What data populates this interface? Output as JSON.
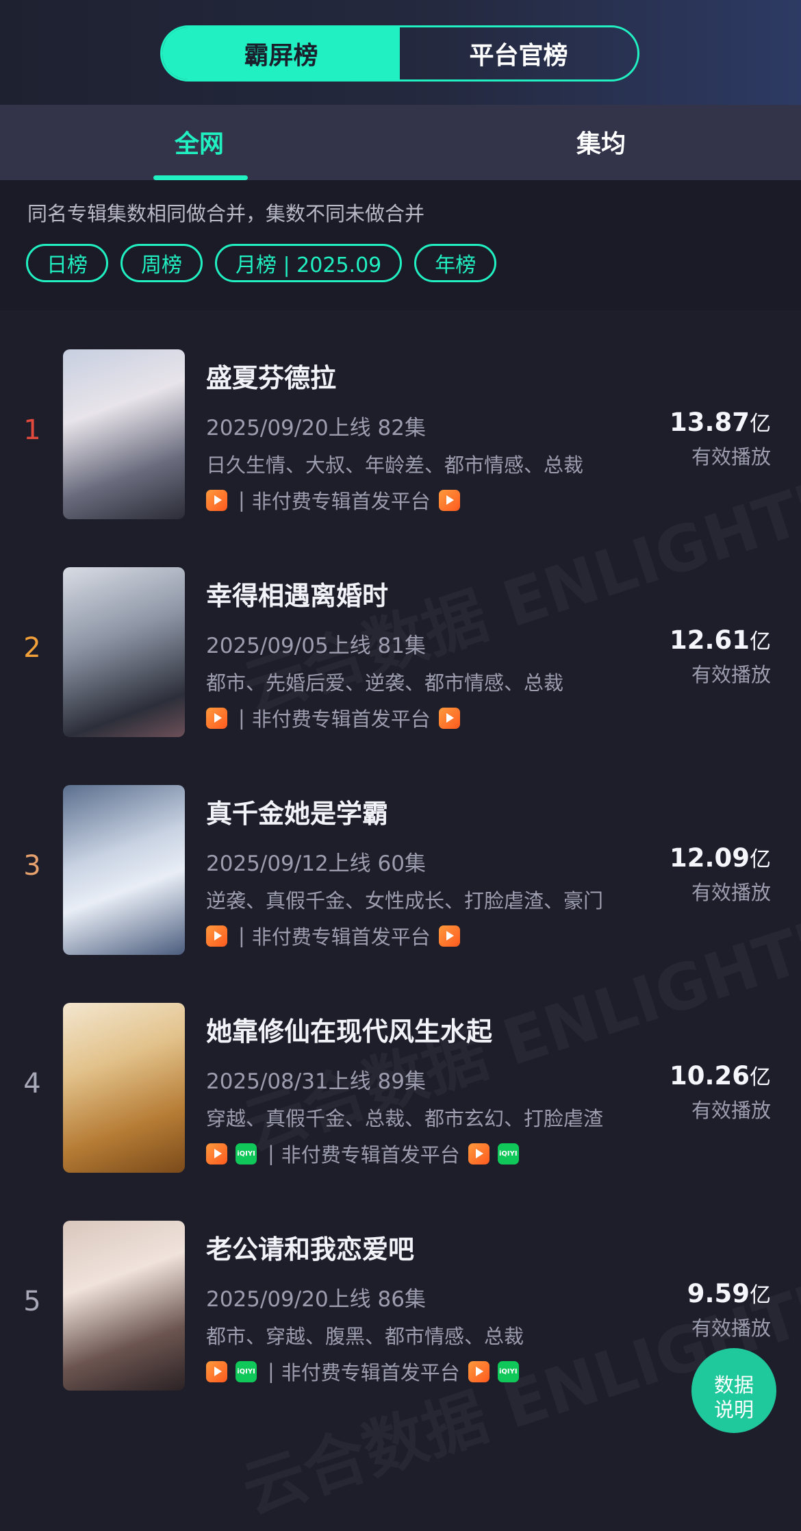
{
  "segments": [
    "霸屏榜",
    "平台官榜"
  ],
  "tabs": [
    "全网",
    "集均"
  ],
  "note": "同名专辑集数相同做合并，集数不同未做合并",
  "pills": [
    "日榜",
    "周榜",
    "月榜 | 2025.09",
    "年榜"
  ],
  "watermark_text": "云合数据 ENLIGHTENT",
  "play_label": "有效播放",
  "platform_text": "非付费专辑首发平台",
  "iqiyi_text": "iQIYI",
  "unit": "亿",
  "colors": {
    "accent": "#21f0c2",
    "rank1": "#e0493b",
    "rank2": "#f5a13a",
    "rank3": "#e7a26d",
    "rank_other": "#a8a9b8"
  },
  "items": [
    {
      "rank": "1",
      "title": "盛夏芬德拉",
      "meta": "2025/09/20上线 82集",
      "tags": "日久生情、大叔、年龄差、都市情感、总裁",
      "value": "13.87",
      "platforms": [
        "orange-play-icon"
      ]
    },
    {
      "rank": "2",
      "title": "幸得相遇离婚时",
      "meta": "2025/09/05上线 81集",
      "tags": "都市、先婚后爱、逆袭、都市情感、总裁",
      "value": "12.61",
      "platforms": [
        "orange-play-icon"
      ]
    },
    {
      "rank": "3",
      "title": "真千金她是学霸",
      "meta": "2025/09/12上线 60集",
      "tags": "逆袭、真假千金、女性成长、打脸虐渣、豪门",
      "value": "12.09",
      "platforms": [
        "orange-play-icon"
      ]
    },
    {
      "rank": "4",
      "title": "她靠修仙在现代风生水起",
      "meta": "2025/08/31上线 89集",
      "tags": "穿越、真假千金、总裁、都市玄幻、打脸虐渣",
      "value": "10.26",
      "platforms": [
        "orange-play-icon",
        "iqiyi-icon"
      ]
    },
    {
      "rank": "5",
      "title": "老公请和我恋爱吧",
      "meta": "2025/09/20上线 86集",
      "tags": "都市、穿越、腹黑、都市情感、总裁",
      "value": "9.59",
      "platforms": [
        "orange-play-icon",
        "iqiyi-icon"
      ]
    }
  ],
  "fab": [
    "数据",
    "说明"
  ]
}
